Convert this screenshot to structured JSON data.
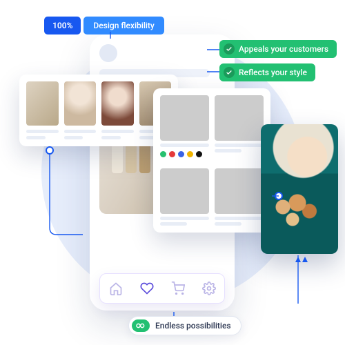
{
  "badges": {
    "top_percent": "100%",
    "top_label": "Design flexibility",
    "green1": "Appeals your customers",
    "green2": "Reflects your style",
    "bottom": "Endless possibilities"
  },
  "swatches": [
    "#27c06f",
    "#e53a3a",
    "#3a62e5",
    "#f0b400",
    "#111111"
  ],
  "icons": {
    "home": "home-icon",
    "heart": "heart-icon",
    "cart": "cart-icon",
    "gear": "gear-icon",
    "check": "check-icon",
    "infinity": "infinity-icon"
  }
}
